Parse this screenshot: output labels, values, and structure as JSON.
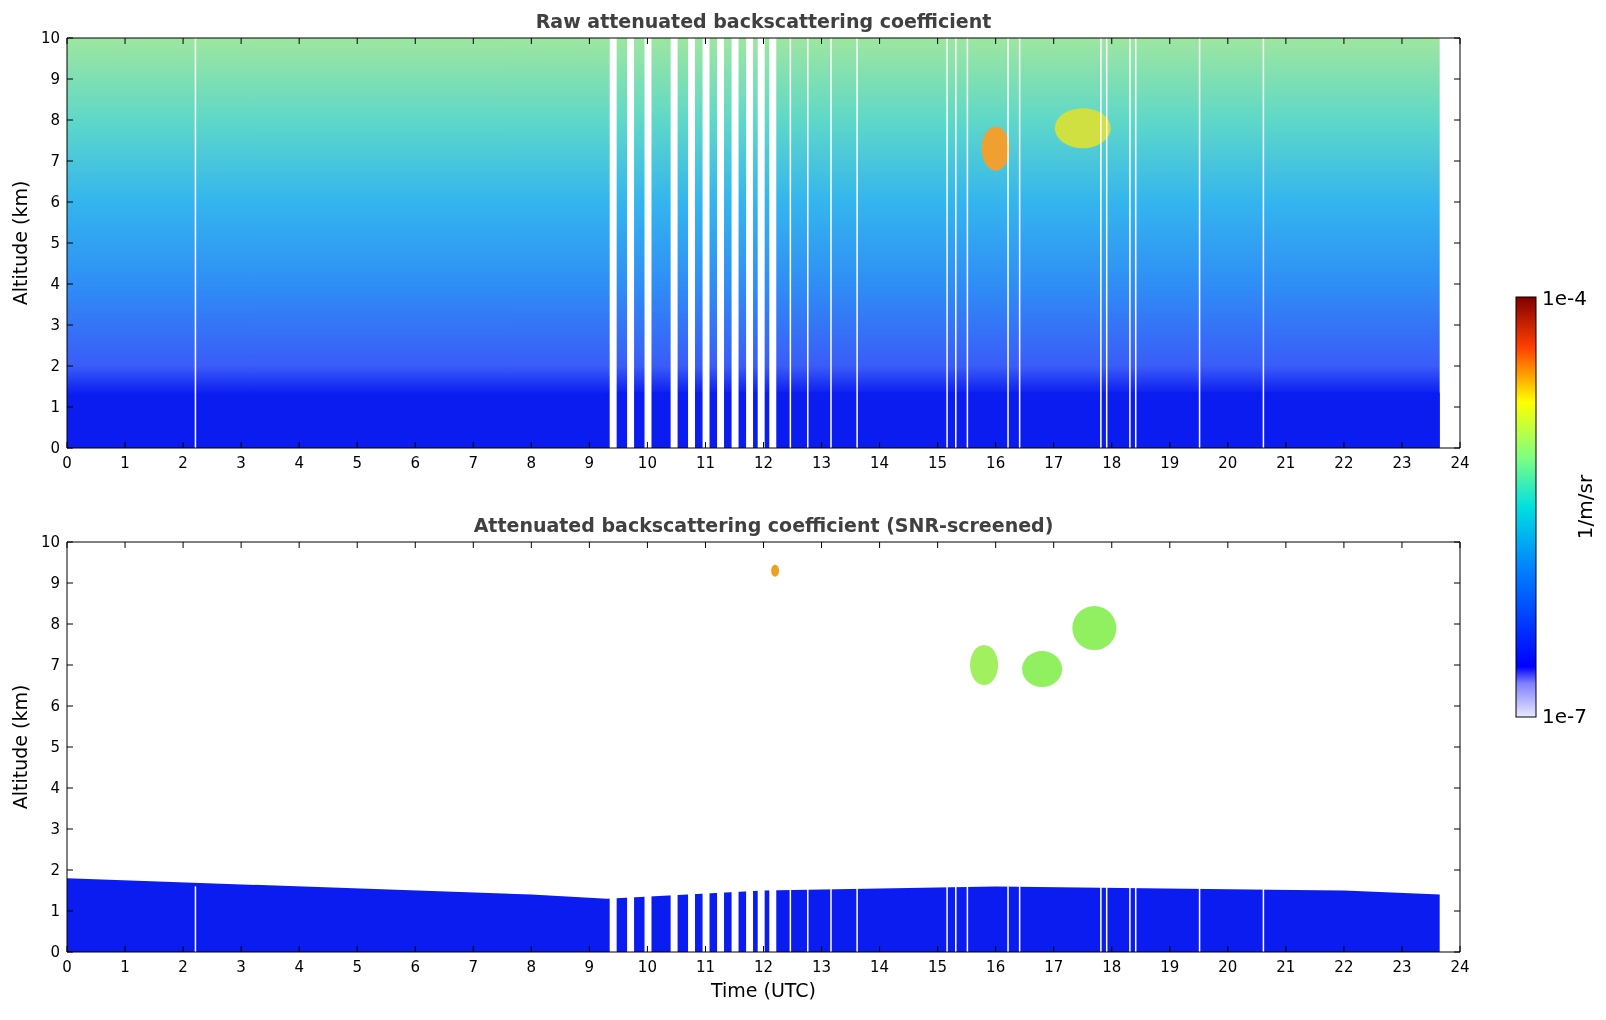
{
  "panels": [
    {
      "kind": "raw",
      "title": "Raw attenuated backscattering coefficient",
      "ylabel": "Altitude (km)",
      "yticks": [
        "10",
        "9",
        "8",
        "7",
        "6",
        "5",
        "4",
        "3",
        "2",
        "1",
        "0"
      ],
      "xticks": [
        "0",
        "1",
        "2",
        "3",
        "4",
        "5",
        "6",
        "7",
        "8",
        "9",
        "10",
        "11",
        "12",
        "13",
        "14",
        "15",
        "16",
        "17",
        "18",
        "19",
        "20",
        "21",
        "22",
        "23",
        "24"
      ]
    },
    {
      "kind": "screened",
      "title": "Attenuated backscattering coefficient (SNR-screened)",
      "ylabel": "Altitude (km)",
      "yticks": [
        "10",
        "9",
        "8",
        "7",
        "6",
        "5",
        "4",
        "3",
        "2",
        "1",
        "0"
      ],
      "xticks": [
        "0",
        "1",
        "2",
        "3",
        "4",
        "5",
        "6",
        "7",
        "8",
        "9",
        "10",
        "11",
        "12",
        "13",
        "14",
        "15",
        "16",
        "17",
        "18",
        "19",
        "20",
        "21",
        "22",
        "23",
        "24"
      ],
      "xlabel": "Time (UTC)"
    }
  ],
  "colorbar": {
    "max_label": "1e-4",
    "min_label": "1e-7",
    "label": "1/m/sr"
  }
}
